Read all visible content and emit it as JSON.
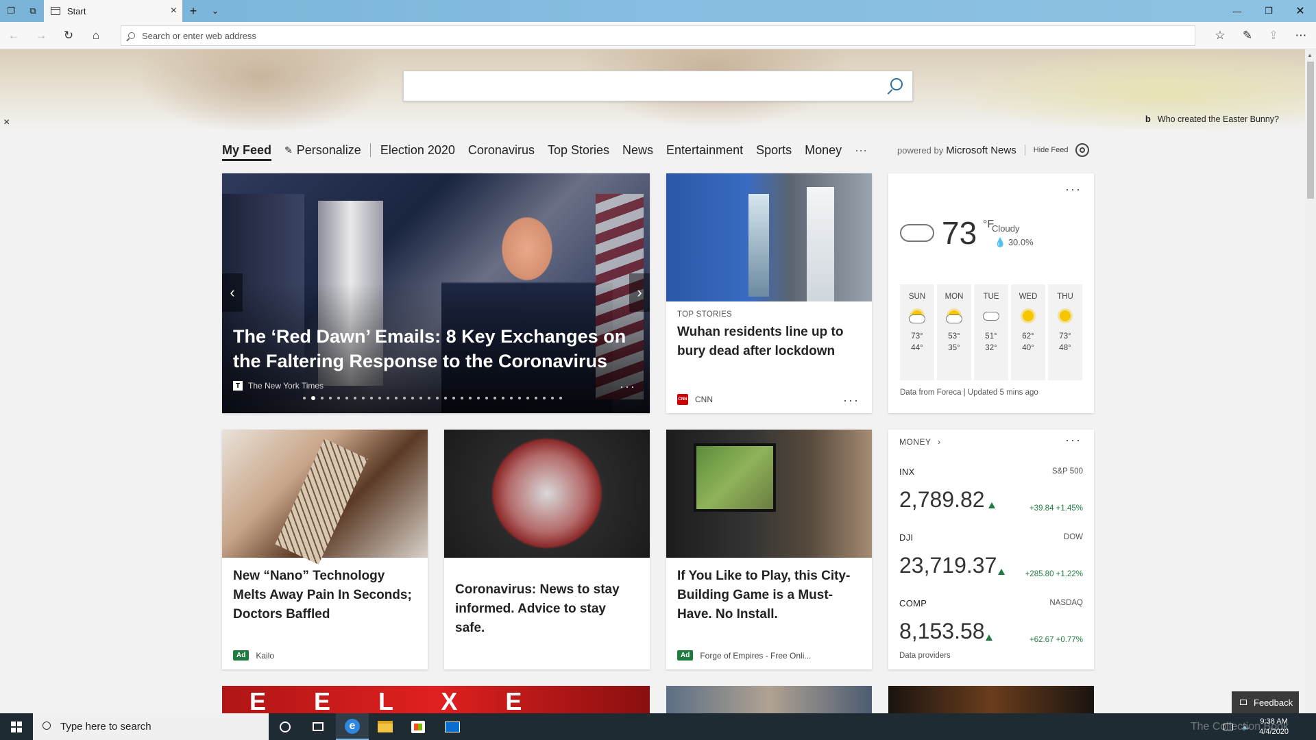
{
  "browser": {
    "tab_title": "Start",
    "address_placeholder": "Search or enter web address"
  },
  "hero": {
    "bing_question": "Who created the Easter Bunny?",
    "bing_mark": "b"
  },
  "feed_nav": {
    "items": [
      "My Feed",
      "Personalize",
      "Election 2020",
      "Coronavirus",
      "Top Stories",
      "News",
      "Entertainment",
      "Sports",
      "Money",
      "···"
    ],
    "powered_by": "powered by",
    "provider": "Microsoft News",
    "hide_feed": "Hide Feed"
  },
  "hero_story": {
    "title": "The ‘Red Dawn’ Emails: 8 Key Exchanges on the Faltering Response to the Coronavirus",
    "source": "The New York Times",
    "source_icon": "T",
    "slide_count": 32,
    "active_slide": 1
  },
  "top_story": {
    "kicker": "TOP STORIES",
    "title": "Wuhan residents line up to bury dead after lockdown",
    "source": "CNN",
    "source_icon": "CNN"
  },
  "weather": {
    "temp": "73",
    "unit": "°F",
    "condition": "Cloudy",
    "precip": "30.0%",
    "days": [
      {
        "day": "SUN",
        "icon": "partly-cloudy-icon",
        "hi": "73°",
        "lo": "44°"
      },
      {
        "day": "MON",
        "icon": "partly-cloudy-icon",
        "hi": "53°",
        "lo": "35°"
      },
      {
        "day": "TUE",
        "icon": "cloud-icon",
        "hi": "51°",
        "lo": "32°"
      },
      {
        "day": "WED",
        "icon": "sun-icon",
        "hi": "62°",
        "lo": "40°"
      },
      {
        "day": "THU",
        "icon": "sun-icon",
        "hi": "73°",
        "lo": "48°"
      }
    ],
    "footer": "Data from Foreca | Updated 5 mins ago"
  },
  "stories_row2": [
    {
      "title": "New “Nano” Technology Melts Away Pain In Seconds; Doctors Baffled",
      "badge": "Ad",
      "source": "Kailo"
    },
    {
      "title": "Coronavirus: News to stay informed. Advice to stay safe."
    },
    {
      "title": "If You Like to Play, this City-Building Game is a Must-Have. No Install.",
      "badge": "Ad",
      "source": "Forge of Empires - Free Onli..."
    }
  ],
  "money": {
    "header": "MONEY",
    "indices": [
      {
        "symbol": "INX",
        "name": "S&P 500",
        "value": "2,789.82",
        "change": "+39.84",
        "pct": "+1.45%"
      },
      {
        "symbol": "DJI",
        "name": "DOW",
        "value": "23,719.37",
        "change": "+285.80",
        "pct": "+1.22%"
      },
      {
        "symbol": "COMP",
        "name": "NASDAQ",
        "value": "8,153.58",
        "change": "+62.67",
        "pct": "+0.77%"
      }
    ],
    "footer": "Data providers"
  },
  "feedback": "Feedback",
  "taskbar": {
    "search_placeholder": "Type here to search",
    "time": "9:38 AM",
    "date": "4/4/2020",
    "watermark": "The Collection Book"
  }
}
